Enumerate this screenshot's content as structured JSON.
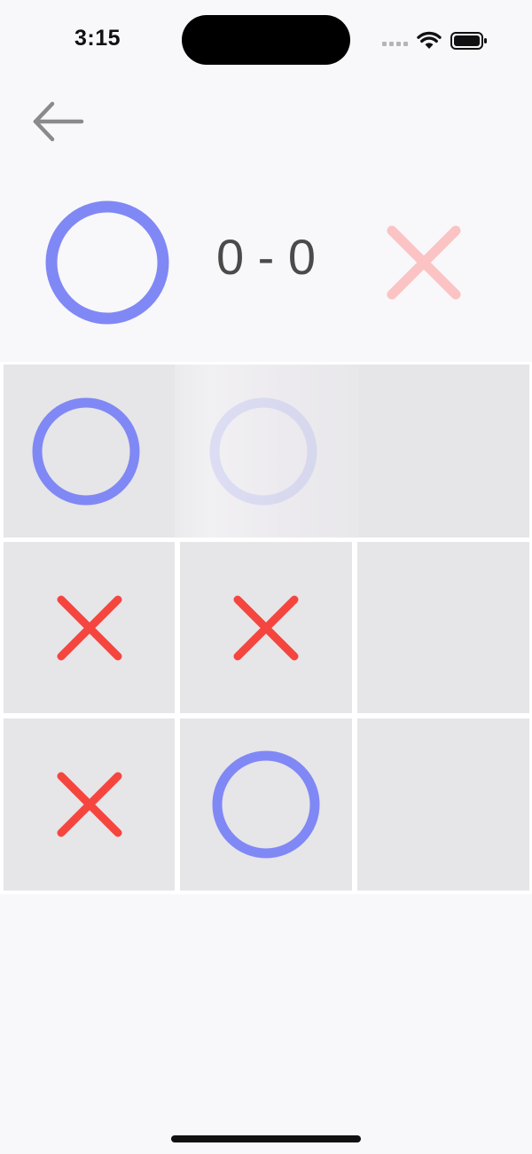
{
  "status_bar": {
    "time": "3:15"
  },
  "navigation": {
    "back_icon": "arrow-left-icon"
  },
  "scoreboard": {
    "player_one_mark": "O",
    "player_two_mark": "X",
    "score": "0 - 0",
    "active_player": "O"
  },
  "board": {
    "cells": [
      {
        "mark": "O"
      },
      {
        "mark": "O",
        "state": "fading"
      },
      {
        "mark": ""
      },
      {
        "mark": "X"
      },
      {
        "mark": "X"
      },
      {
        "mark": ""
      },
      {
        "mark": "X"
      },
      {
        "mark": "O"
      },
      {
        "mark": ""
      }
    ]
  },
  "colors": {
    "o_mark": "#8088f5",
    "x_mark": "#f5453f",
    "x_inactive": "#fbc3c3",
    "cell_bg": "#e6e5e8",
    "background": "#f8f7fa"
  }
}
